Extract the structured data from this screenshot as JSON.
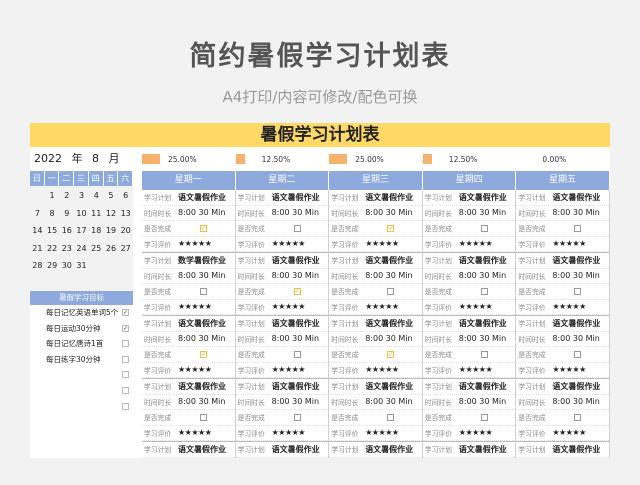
{
  "page": {
    "title": "简约暑假学习计划表",
    "subtitle": "A4打印/内容可修改/配色可换"
  },
  "sheet": {
    "banner": "暑假学习计划表",
    "date": {
      "year": "2022",
      "year_unit": "年",
      "month": "8",
      "month_unit": "月"
    },
    "calendar": {
      "weekdays": [
        "日",
        "一",
        "二",
        "三",
        "四",
        "五",
        "六"
      ],
      "rows": [
        [
          "",
          "1",
          "2",
          "3",
          "4",
          "5",
          "6"
        ],
        [
          "7",
          "8",
          "9",
          "10",
          "11",
          "12",
          "13"
        ],
        [
          "14",
          "15",
          "16",
          "17",
          "18",
          "19",
          "20"
        ],
        [
          "21",
          "22",
          "23",
          "24",
          "25",
          "26",
          "27"
        ],
        [
          "28",
          "29",
          "30",
          "31",
          "",
          "",
          ""
        ]
      ]
    },
    "goals": {
      "header": "暑假学习目标",
      "items": [
        {
          "label": "每日记忆英语单词5个",
          "checked": true
        },
        {
          "label": "每日运动30分钟",
          "checked": true
        },
        {
          "label": "每日记忆唐诗1首",
          "checked": false
        },
        {
          "label": "每日练字30分钟",
          "checked": false
        },
        {
          "label": "",
          "checked": false
        },
        {
          "label": "",
          "checked": false
        },
        {
          "label": "",
          "checked": false
        }
      ]
    },
    "progress": [
      {
        "label": "25.00%",
        "value": 0.25
      },
      {
        "label": "12.50%",
        "value": 0.125
      },
      {
        "label": "25.00%",
        "value": 0.25
      },
      {
        "label": "12.50%",
        "value": 0.125
      },
      {
        "label": "0.00%",
        "value": 0.0
      }
    ],
    "days": [
      "星期一",
      "星期二",
      "星期三",
      "星期四",
      "星期五"
    ],
    "labels": {
      "plan": "学习计划",
      "time": "时间时长",
      "done": "是否完成",
      "rating": "学习评价"
    },
    "time_value": "8:00   30 Min",
    "stars": "★★★★★",
    "plans": [
      [
        "语文暑假作业",
        "语文暑假作业",
        "语文暑假作业",
        "语文暑假作业",
        "语文暑假作业"
      ],
      [
        "数学暑假作业",
        "语文暑假作业",
        "语文暑假作业",
        "语文暑假作业",
        "语文暑假作业"
      ],
      [
        "语文暑假作业",
        "语文暑假作业",
        "语文暑假作业",
        "语文暑假作业",
        "语文暑假作业"
      ],
      [
        "语文暑假作业",
        "语文暑假作业",
        "语文暑假作业",
        "语文暑假作业",
        "语文暑假作业"
      ],
      [
        "语文暑假作业",
        "语文暑假作业",
        "语文暑假作业",
        "语文暑假作业",
        "语文暑假作业"
      ]
    ],
    "done": [
      [
        true,
        false,
        true,
        false,
        false
      ],
      [
        false,
        true,
        false,
        false,
        false
      ],
      [
        true,
        false,
        true,
        false,
        false
      ],
      [
        false,
        false,
        false,
        false,
        false
      ],
      [
        false,
        false,
        false,
        false,
        false
      ]
    ]
  }
}
